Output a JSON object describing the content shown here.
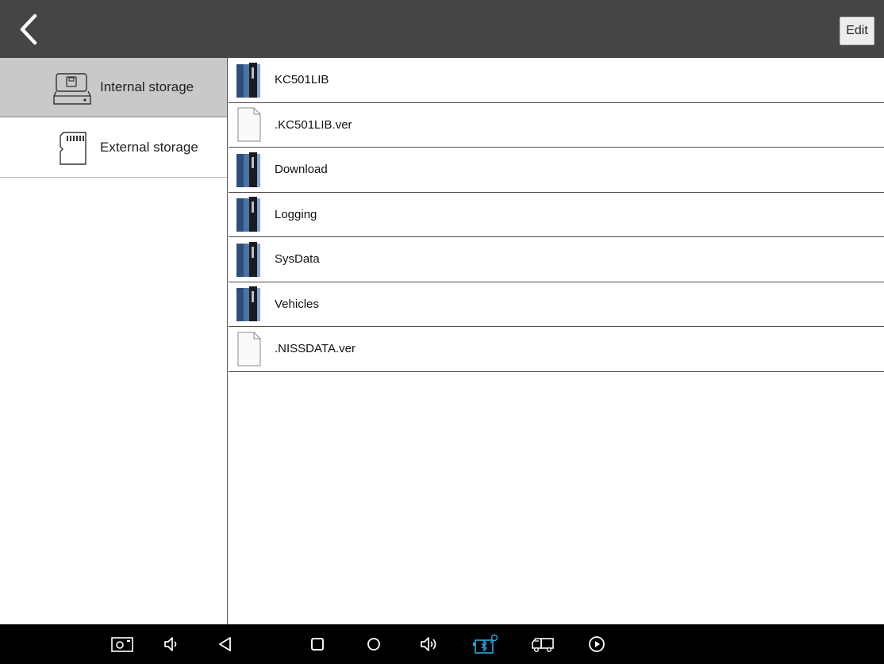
{
  "header": {
    "back_icon": "chevron-left-icon",
    "edit_label": "Edit"
  },
  "sidebar": {
    "items": [
      {
        "label": "Internal storage",
        "icon": "hard-drive-icon",
        "selected": true
      },
      {
        "label": "External storage",
        "icon": "sd-card-icon",
        "selected": false
      }
    ]
  },
  "files": [
    {
      "name": "KC501LIB",
      "type": "folder"
    },
    {
      "name": ".KC501LIB.ver",
      "type": "file"
    },
    {
      "name": "Download",
      "type": "folder"
    },
    {
      "name": "Logging",
      "type": "folder"
    },
    {
      "name": "SysData",
      "type": "folder"
    },
    {
      "name": "Vehicles",
      "type": "folder"
    },
    {
      "name": ".NISSDATA.ver",
      "type": "file"
    }
  ],
  "navbar": {
    "icons": [
      "screenshot-icon",
      "volume-down-icon",
      "back-triangle-icon",
      "recents-square-icon",
      "home-circle-icon",
      "volume-up-icon",
      "vci-bluetooth-icon",
      "vehicle-icon",
      "play-icon"
    ],
    "accent": "#29a9e1"
  }
}
